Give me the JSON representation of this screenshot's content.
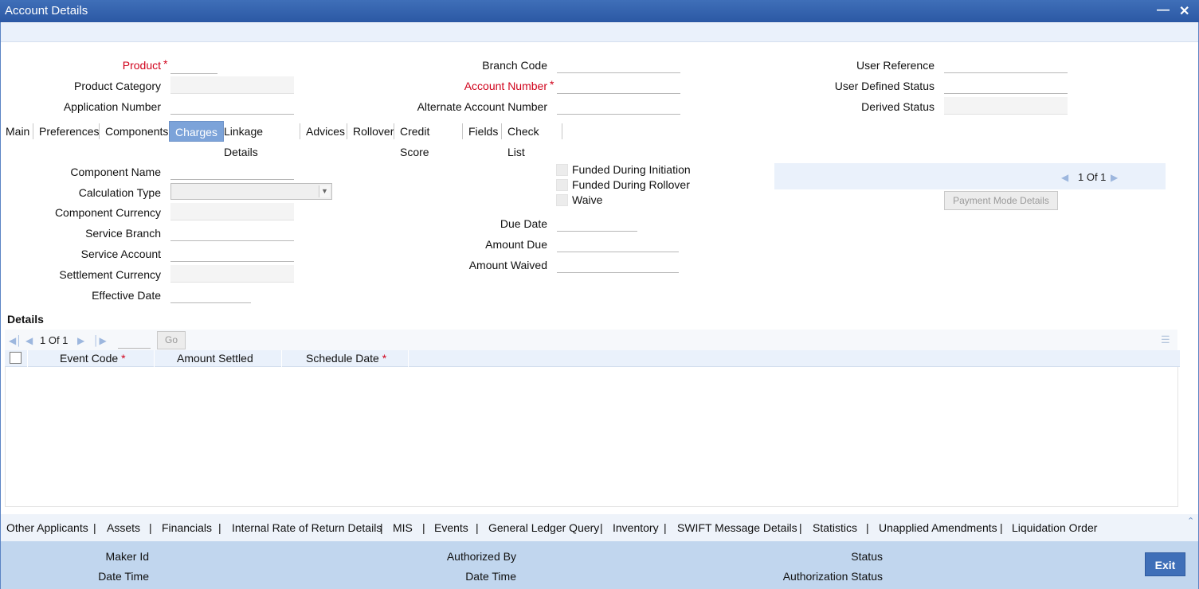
{
  "window": {
    "title": "Account Details",
    "minimize_icon": "minimize-icon",
    "close_icon": "close-icon"
  },
  "header": {
    "product_label": "Product",
    "product_value": "",
    "product_category_label": "Product Category",
    "product_category_value": "",
    "application_number_label": "Application Number",
    "application_number_value": "",
    "branch_code_label": "Branch Code",
    "branch_code_value": "",
    "account_number_label": "Account Number",
    "account_number_value": "",
    "alternate_account_number_label": "Alternate Account Number",
    "alternate_account_number_value": "",
    "user_reference_label": "User Reference",
    "user_reference_value": "",
    "user_defined_status_label": "User Defined Status",
    "user_defined_status_value": "",
    "derived_status_label": "Derived Status",
    "derived_status_value": "",
    "required_marker": "*"
  },
  "tabs": [
    "Main",
    "Preferences",
    "Components",
    "Charges",
    "Linkage Details",
    "Advices",
    "Rollover",
    "Credit Score",
    "Fields",
    "Check List"
  ],
  "active_tab": "Charges",
  "charges": {
    "component_name_label": "Component Name",
    "calculation_type_label": "Calculation Type",
    "component_currency_label": "Component Currency",
    "service_branch_label": "Service Branch",
    "service_account_label": "Service Account",
    "settlement_currency_label": "Settlement Currency",
    "effective_date_label": "Effective Date",
    "funded_during_initiation_label": "Funded During Initiation",
    "funded_during_rollover_label": "Funded During Rollover",
    "waive_label": "Waive",
    "due_date_label": "Due Date",
    "amount_due_label": "Amount Due",
    "amount_waived_label": "Amount Waived",
    "pager_text": "1 Of 1",
    "payment_mode_button": "Payment Mode Details"
  },
  "details": {
    "title": "Details",
    "pager_text": "1 Of 1",
    "go_button": "Go",
    "columns": [
      "Event Code",
      "Amount Settled",
      "Schedule Date"
    ],
    "rows": []
  },
  "links": [
    "Other Applicants",
    "Assets",
    "Financials",
    "Internal Rate of Return Details",
    "MIS",
    "Events",
    "General Ledger Query",
    "Inventory",
    "SWIFT Message Details",
    "Statistics",
    "Unapplied Amendments",
    "Liquidation Order"
  ],
  "link_separator": "|",
  "footer": {
    "maker_id": "Maker Id",
    "date_time_1": "Date Time",
    "authorized_by": "Authorized By",
    "date_time_2": "Date Time",
    "status": "Status",
    "authorization_status": "Authorization Status",
    "exit_button": "Exit"
  },
  "colors": {
    "titlebar": "#2f5fa9",
    "active_tab": "#7ca3d9",
    "required": "#d0021b",
    "footer": "#c1d6ee"
  }
}
